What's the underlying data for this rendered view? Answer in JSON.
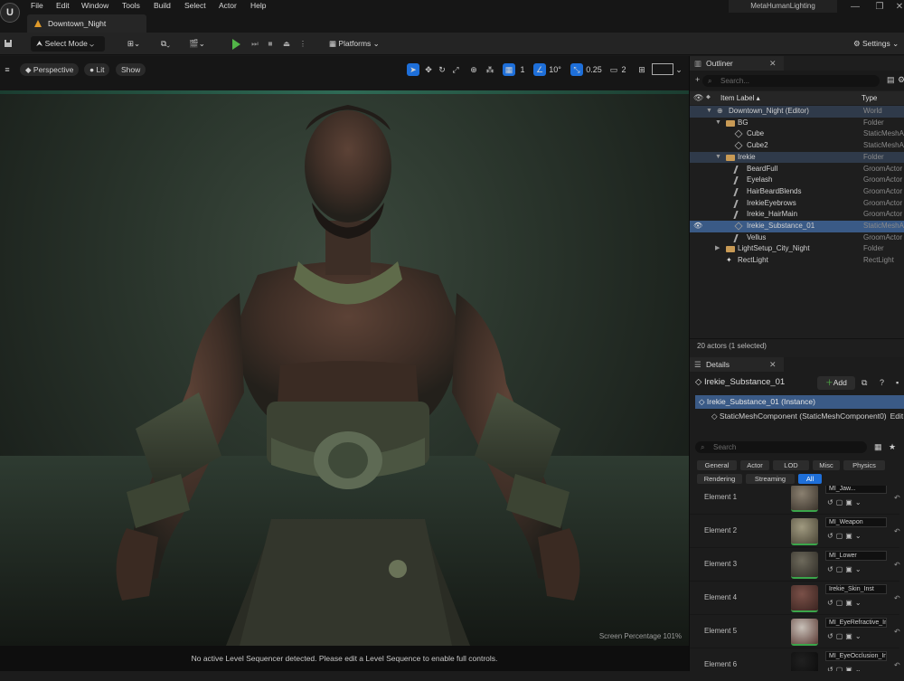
{
  "menu": [
    "File",
    "Edit",
    "Window",
    "Tools",
    "Build",
    "Select",
    "Actor",
    "Help"
  ],
  "project_tab": "Downtown_Night",
  "project_name": "MetaHumanLighting",
  "window_controls": [
    "—",
    "❐",
    "✕"
  ],
  "toolbar": {
    "select_mode": "Select Mode",
    "platforms": "Platforms",
    "settings": "Settings"
  },
  "viewport": {
    "perspective": "Perspective",
    "lit": "Lit",
    "show": "Show",
    "grid_snap": "1",
    "angle_snap": "10°",
    "scale_snap": "0.25",
    "camera_speed": "2",
    "screen_percentage": "Screen Percentage  101%",
    "sequencer_message": "No active Level Sequencer detected. Please edit a Level Sequence to enable full controls."
  },
  "outliner": {
    "tab": "Outliner",
    "search_placeholder": "Search...",
    "col_label": "Item Label ▴",
    "col_type": "Type",
    "rows": [
      {
        "label": "Downtown_Night (Editor)",
        "type": "World",
        "icon": "world-icon"
      },
      {
        "label": "BG",
        "type": "Folder",
        "icon": "folder-icon"
      },
      {
        "label": "Cube",
        "type": "StaticMeshActor",
        "icon": "mesh-icon"
      },
      {
        "label": "Cube2",
        "type": "StaticMeshActor",
        "icon": "mesh-icon"
      },
      {
        "label": "Irekie",
        "type": "Folder",
        "icon": "folder-icon"
      },
      {
        "label": "BeardFull",
        "type": "GroomActor",
        "icon": "groom-icon"
      },
      {
        "label": "Eyelash",
        "type": "GroomActor",
        "icon": "groom-icon"
      },
      {
        "label": "HairBeardBlends",
        "type": "GroomActor",
        "icon": "groom-icon"
      },
      {
        "label": "IrekieEyebrows",
        "type": "GroomActor",
        "icon": "groom-icon"
      },
      {
        "label": "Irekie_HairMain",
        "type": "GroomActor",
        "icon": "groom-icon"
      },
      {
        "label": "Irekie_Substance_01",
        "type": "StaticMeshActor",
        "icon": "mesh-icon"
      },
      {
        "label": "Vellus",
        "type": "GroomActor",
        "icon": "groom-icon"
      },
      {
        "label": "LightSetup_City_Night",
        "type": "Folder",
        "icon": "folder-icon"
      },
      {
        "label": "RectLight",
        "type": "RectLight",
        "icon": "light-icon"
      }
    ],
    "status": "20 actors (1 selected)"
  },
  "details": {
    "tab": "Details",
    "actor_name": "Irekie_Substance_01",
    "add_label": "Add",
    "instance_label": "Irekie_Substance_01 (Instance)",
    "component_label": "StaticMeshComponent (StaticMeshComponent0)",
    "edit_label": "Edit",
    "search_placeholder": "Search",
    "filters": [
      "General",
      "Actor",
      "LOD",
      "Misc",
      "Physics",
      "Rendering",
      "Streaming",
      "All"
    ],
    "active_filter": "All",
    "elements": [
      {
        "label": "Element 1",
        "material": "MI_Jaw..."
      },
      {
        "label": "Element 2",
        "material": "MI_Weapon"
      },
      {
        "label": "Element 3",
        "material": "MI_Lower"
      },
      {
        "label": "Element 4",
        "material": "Irekie_Skin_Inst"
      },
      {
        "label": "Element 5",
        "material": "MI_EyeRefractive_Ins"
      },
      {
        "label": "Element 6",
        "material": "MI_EyeOcclusion_Inst"
      }
    ]
  },
  "colors": {
    "accent": "#1e6fd9",
    "play": "#52b548",
    "selection": "#3a5a86",
    "folder": "#c89a55",
    "material_ok": "#3aa64a"
  }
}
